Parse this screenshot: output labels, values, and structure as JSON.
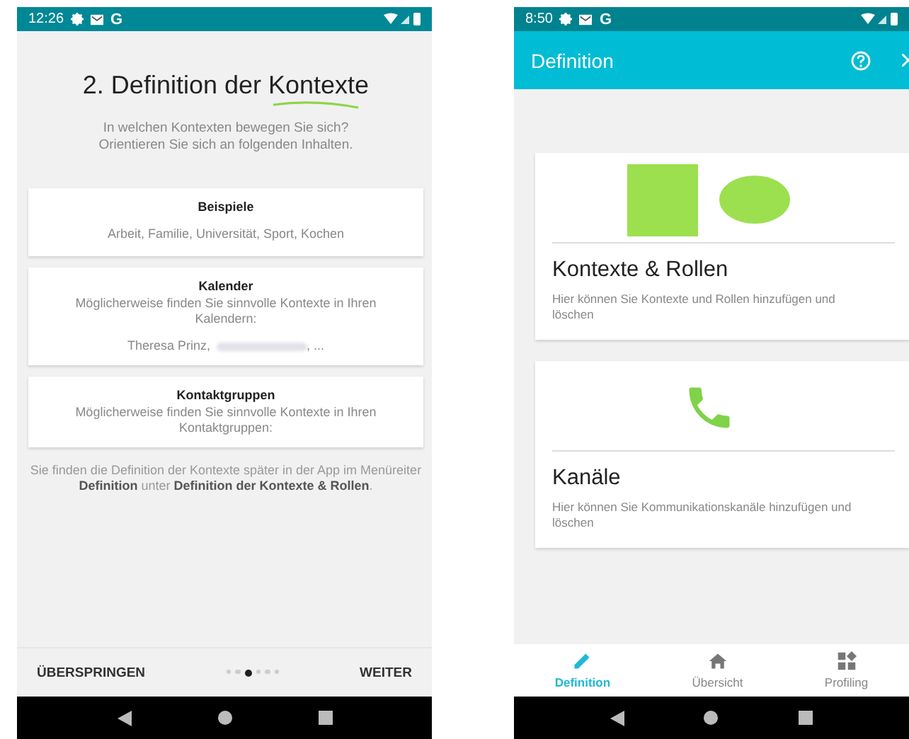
{
  "onboarding_screen": {
    "status_bar": {
      "time": "12:26",
      "app_letter": "G"
    },
    "title": {
      "text": "2. Definition der",
      "highlight": "Kontexte"
    },
    "intro": [
      "In welchen Kontexten bewegen Sie sich?",
      "Orientieren Sie sich an folgenden Inhalten."
    ],
    "cards": [
      {
        "title": "Beispiele",
        "text": "Arbeit, Familie, Universität, Sport, Kochen"
      },
      {
        "title": "Kalender",
        "text": "Möglicherweise finden Sie sinnvolle Kontexte in Ihren Kalendern:",
        "account": {
          "name": "Theresa Prinz,",
          "redacted": true,
          "more": ", ..."
        }
      },
      {
        "title": "Kontaktgruppen",
        "text": "Möglicherweise finden Sie sinnvolle Kontexte in Ihren Kontaktgruppen:"
      }
    ],
    "note": "Sie finden die Definition der Kontexte später in der App im Menüreiter **Definition** unter **Definition der Kontexte & Rollen**.",
    "skip_button": "ÜBERSPRINGEN",
    "next_button": "WEITER",
    "pager_dots": [
      {
        "selected": false
      },
      {
        "selected": false
      },
      {
        "selected": true
      },
      {
        "selected": false
      },
      {
        "selected": false
      },
      {
        "selected": false
      }
    ]
  },
  "definition_screen": {
    "status_bar": {
      "time": "8:50",
      "app_letter": "G"
    },
    "app_bar": {
      "title": "Definition"
    },
    "cards": [
      {
        "kind": "shapes",
        "title": "Kontexte & Rollen",
        "text": "Hier können Sie Kontexte und Rollen hinzufügen und löschen"
      },
      {
        "kind": "phone",
        "title": "Kanäle",
        "text": "Hier können Sie Kommunikationskanäle hinzufügen und löschen"
      }
    ],
    "bottom_nav": [
      {
        "kind": "pencil",
        "label": "Definition",
        "selected": true
      },
      {
        "kind": "home",
        "label": "Übersicht",
        "selected": false
      },
      {
        "kind": "grid",
        "label": "Profiling",
        "selected": false
      }
    ]
  }
}
